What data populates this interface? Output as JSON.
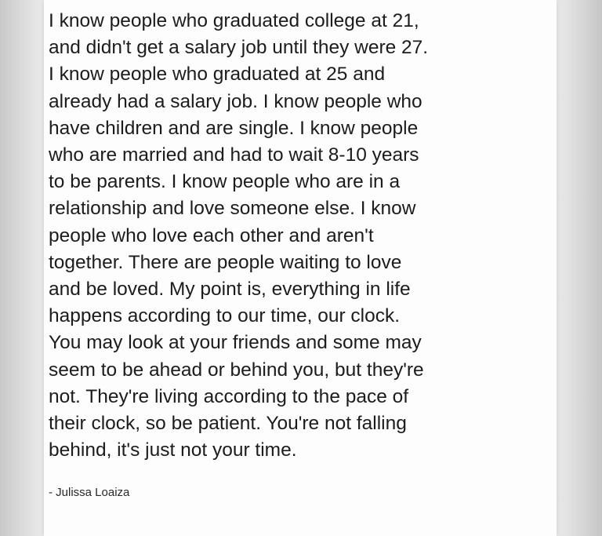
{
  "quote": {
    "lines": [
      "I know people who graduated college at 21,",
      "and didn't get a salary job until they were 27.",
      "I know people who graduated at 25 and",
      "already had a salary job. I know people who",
      "have children and are single. I know people",
      "who are married and had to wait 8-10 years",
      "to be parents. I know people who are in a",
      "relationship and love someone else. I know",
      "people who love each other and aren't",
      "together. There are people waiting to love",
      "and be loved. My point is, everything in life",
      "happens according to our time, our clock.",
      "You may look at your friends and some may",
      "seem to be ahead or behind you, but they're",
      "not. They're living according to the pace of",
      "their clock, so be patient. You're not falling",
      "behind, it's just not your time."
    ],
    "author": "- Julissa Loaiza"
  }
}
